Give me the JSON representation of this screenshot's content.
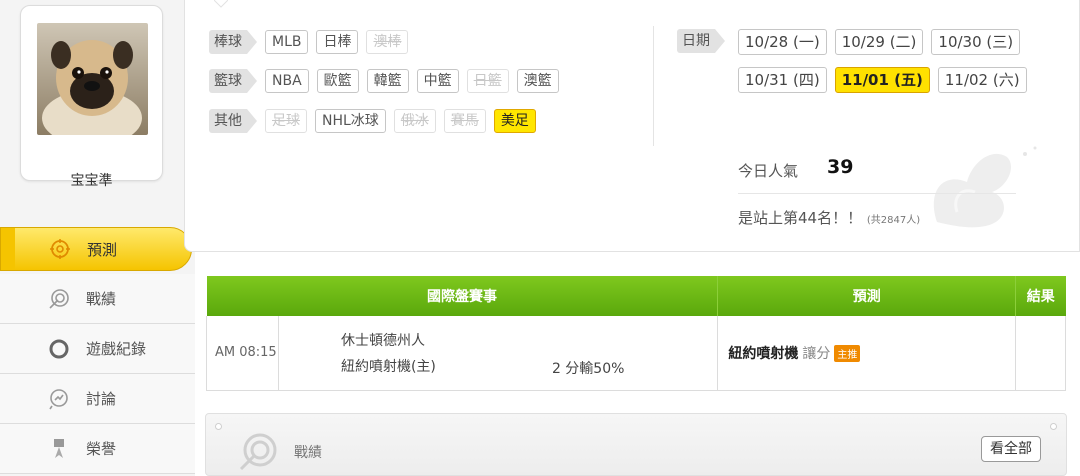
{
  "profile": {
    "username": "宝宝準",
    "avatar_icon": "pug-dog-photo"
  },
  "menu": [
    {
      "label": "預測",
      "icon": "target-icon",
      "active": true
    },
    {
      "label": "戰績",
      "icon": "bullseye-icon",
      "active": false
    },
    {
      "label": "遊戲紀錄",
      "icon": "circle-icon",
      "active": false
    },
    {
      "label": "討論",
      "icon": "magnifier-chat-icon",
      "active": false
    },
    {
      "label": "榮譽",
      "icon": "trophy-icon",
      "active": false
    }
  ],
  "filters": {
    "baseball": {
      "label": "棒球",
      "items": [
        {
          "label": "MLB",
          "state": "normal"
        },
        {
          "label": "日棒",
          "state": "normal"
        },
        {
          "label": "澳棒",
          "state": "disabled"
        }
      ]
    },
    "basketball": {
      "label": "籃球",
      "items": [
        {
          "label": "NBA",
          "state": "normal"
        },
        {
          "label": "歐籃",
          "state": "normal"
        },
        {
          "label": "韓籃",
          "state": "normal"
        },
        {
          "label": "中籃",
          "state": "normal"
        },
        {
          "label": "日籃",
          "state": "disabled"
        },
        {
          "label": "澳籃",
          "state": "normal"
        }
      ]
    },
    "other": {
      "label": "其他",
      "items": [
        {
          "label": "足球",
          "state": "disabled"
        },
        {
          "label": "NHL冰球",
          "state": "normal"
        },
        {
          "label": "俄冰",
          "state": "disabled"
        },
        {
          "label": "賽馬",
          "state": "disabled"
        },
        {
          "label": "美足",
          "state": "active"
        }
      ]
    }
  },
  "dates": {
    "label": "日期",
    "row1": [
      "10/28 (一)",
      "10/29 (二)",
      "10/30 (三)"
    ],
    "row2": [
      "10/31 (四)",
      "11/01 (五)",
      "11/02 (六)"
    ],
    "selected": "11/01 (五)"
  },
  "stats": {
    "popularity_label": "今日人氣",
    "popularity_value": "39",
    "rank_text": "是站上第44名！！",
    "rank_total": "(共2847人)"
  },
  "table": {
    "headers": [
      "國際盤賽事",
      "預測",
      "結果"
    ],
    "rows": [
      {
        "time": "AM 08:15",
        "team_top": "休士頓德州人",
        "team_bottom": "紐約噴射機(主)",
        "line": "2 分輸50%",
        "pick_team": "紐約噴射機",
        "pick_type": "讓分",
        "pick_badge": "主推",
        "result": ""
      }
    ]
  },
  "record": {
    "label": "戰績",
    "view_all": "看全部"
  },
  "colors": {
    "accent_yellow": "#ffe600",
    "table_header_green": "#6ab615",
    "badge_orange": "#f08a00"
  }
}
